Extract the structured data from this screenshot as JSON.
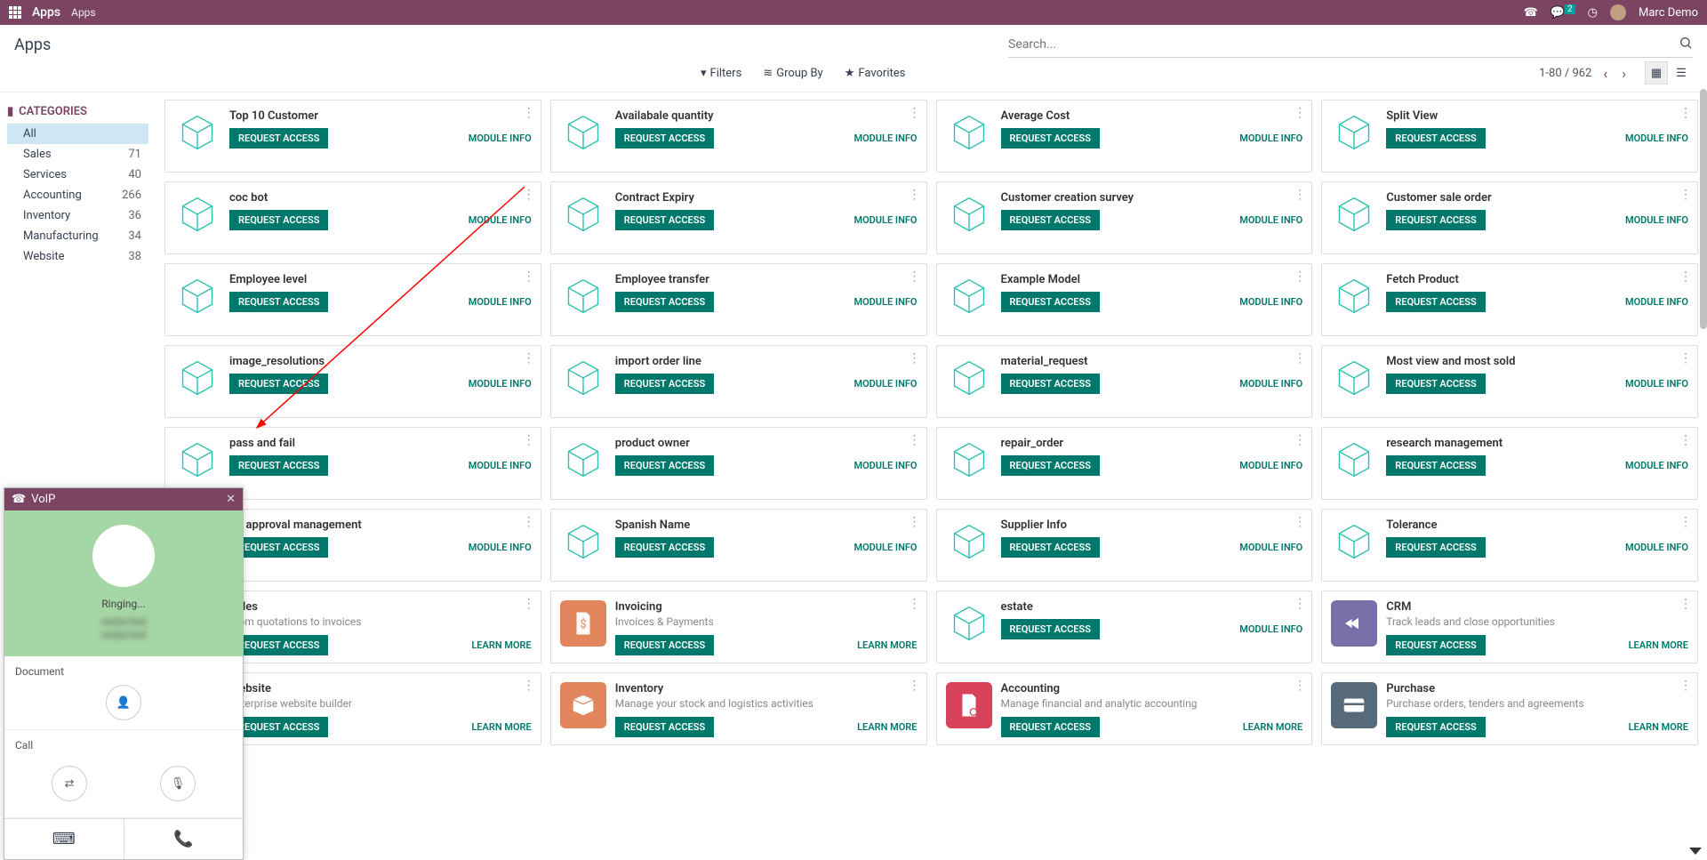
{
  "topbar": {
    "brand": "Apps",
    "breadcrumb": "Apps",
    "msg_count": "2",
    "user": "Marc Demo"
  },
  "page": {
    "title": "Apps"
  },
  "search": {
    "placeholder": "Search..."
  },
  "filters": {
    "filters": "Filters",
    "groupby": "Group By",
    "favorites": "Favorites"
  },
  "pager": {
    "text": "1-80 / 962"
  },
  "sidebar": {
    "heading": "CATEGORIES",
    "items": [
      {
        "label": "All",
        "count": ""
      },
      {
        "label": "Sales",
        "count": "71"
      },
      {
        "label": "Services",
        "count": "40"
      },
      {
        "label": "Accounting",
        "count": "266"
      },
      {
        "label": "Inventory",
        "count": "36"
      },
      {
        "label": "Manufacturing",
        "count": "34"
      },
      {
        "label": "Website",
        "count": "38"
      }
    ]
  },
  "buttons": {
    "request": "REQUEST ACCESS",
    "module_info": "MODULE INFO",
    "learn_more": "LEARN MORE"
  },
  "cards": [
    {
      "title": "Top 10 Customer",
      "sub": "",
      "action": "module_info",
      "icon": "cube"
    },
    {
      "title": "Availabale quantity",
      "sub": "",
      "action": "module_info",
      "icon": "cube"
    },
    {
      "title": "Average Cost",
      "sub": "",
      "action": "module_info",
      "icon": "cube"
    },
    {
      "title": "Split View",
      "sub": "",
      "action": "module_info",
      "icon": "cube"
    },
    {
      "title": "coc bot",
      "sub": "",
      "action": "module_info",
      "icon": "cube"
    },
    {
      "title": "Contract Expiry",
      "sub": "",
      "action": "module_info",
      "icon": "cube"
    },
    {
      "title": "Customer creation survey",
      "sub": "",
      "action": "module_info",
      "icon": "cube"
    },
    {
      "title": "Customer sale order",
      "sub": "",
      "action": "module_info",
      "icon": "cube"
    },
    {
      "title": "Employee level",
      "sub": "",
      "action": "module_info",
      "icon": "cube"
    },
    {
      "title": "Employee transfer",
      "sub": "",
      "action": "module_info",
      "icon": "cube"
    },
    {
      "title": "Example Model",
      "sub": "",
      "action": "module_info",
      "icon": "cube"
    },
    {
      "title": "Fetch Product",
      "sub": "",
      "action": "module_info",
      "icon": "cube"
    },
    {
      "title": "image_resolutions",
      "sub": "",
      "action": "module_info",
      "icon": "cube"
    },
    {
      "title": "import order line",
      "sub": "",
      "action": "module_info",
      "icon": "cube"
    },
    {
      "title": "material_request",
      "sub": "",
      "action": "module_info",
      "icon": "cube"
    },
    {
      "title": "Most view and most sold",
      "sub": "",
      "action": "module_info",
      "icon": "cube"
    },
    {
      "title": "pass and fail",
      "sub": "",
      "action": "module_info",
      "icon": "cube"
    },
    {
      "title": "product owner",
      "sub": "",
      "action": "module_info",
      "icon": "cube"
    },
    {
      "title": "repair_order",
      "sub": "",
      "action": "module_info",
      "icon": "cube"
    },
    {
      "title": "research management",
      "sub": "",
      "action": "module_info",
      "icon": "cube"
    },
    {
      "title": "So approval management",
      "sub": "",
      "action": "module_info",
      "icon": "cube"
    },
    {
      "title": "Spanish Name",
      "sub": "",
      "action": "module_info",
      "icon": "cube"
    },
    {
      "title": "Supplier Info",
      "sub": "",
      "action": "module_info",
      "icon": "cube"
    },
    {
      "title": "Tolerance",
      "sub": "",
      "action": "module_info",
      "icon": "cube"
    },
    {
      "title": "Sales",
      "sub": "From quotations to invoices",
      "action": "learn_more",
      "icon": "cube"
    },
    {
      "title": "Invoicing",
      "sub": "Invoices & Payments",
      "action": "learn_more",
      "icon": "orange-doc"
    },
    {
      "title": "estate",
      "sub": "",
      "action": "module_info",
      "icon": "cube"
    },
    {
      "title": "CRM",
      "sub": "Track leads and close opportunities",
      "action": "learn_more",
      "icon": "purple-hand"
    },
    {
      "title": "Website",
      "sub": "Enterprise website builder",
      "action": "learn_more",
      "icon": "cube"
    },
    {
      "title": "Inventory",
      "sub": "Manage your stock and logistics activities",
      "action": "learn_more",
      "icon": "orange-box"
    },
    {
      "title": "Accounting",
      "sub": "Manage financial and analytic accounting",
      "action": "learn_more",
      "icon": "red-doc"
    },
    {
      "title": "Purchase",
      "sub": "Purchase orders, tenders and agreements",
      "action": "learn_more",
      "icon": "slate-card"
    }
  ],
  "voip": {
    "title": "VoIP",
    "status": "Ringing...",
    "contact1": "redacted",
    "contact2": "redacted",
    "doc_label": "Document",
    "call_label": "Call"
  }
}
